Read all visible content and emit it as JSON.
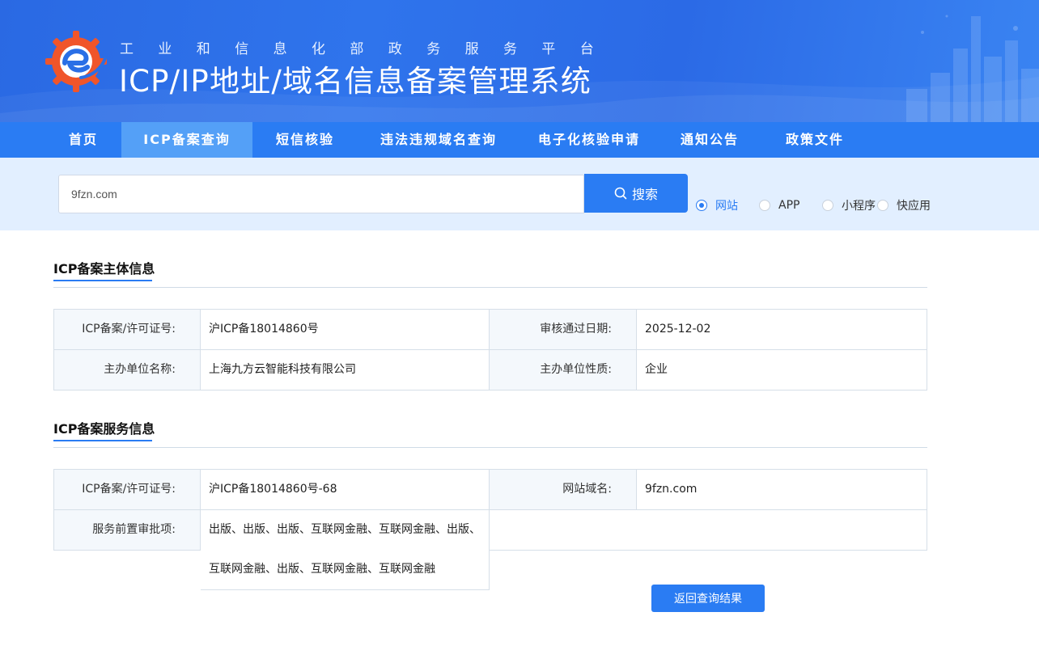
{
  "header": {
    "subtitle": "工业和信息化部政务服务平台",
    "title": "ICP/IP地址/域名信息备案管理系统"
  },
  "nav": {
    "items": [
      "首页",
      "ICP备案查询",
      "短信核验",
      "违法违规域名查询",
      "电子化核验申请",
      "通知公告",
      "政策文件"
    ],
    "active_index": 1
  },
  "search": {
    "value": "9fzn.com",
    "button_label": "搜索",
    "types": [
      "网站",
      "APP",
      "小程序",
      "快应用"
    ],
    "selected_type": "网站"
  },
  "subject_info": {
    "title": "ICP备案主体信息",
    "license_label": "ICP备案/许可证号:",
    "license_value": "沪ICP备18014860号",
    "approval_date_label": "审核通过日期:",
    "approval_date_value": "2025-12-02",
    "organizer_label": "主办单位名称:",
    "organizer_value": "上海九方云智能科技有限公司",
    "nature_label": "主办单位性质:",
    "nature_value": "企业"
  },
  "service_info": {
    "title": "ICP备案服务信息",
    "license_label": "ICP备案/许可证号:",
    "license_value": "沪ICP备18014860号-68",
    "domain_label": "网站域名:",
    "domain_value": "9fzn.com",
    "pre_approval_label": "服务前置审批项:",
    "pre_approval_line1": "出版、出版、出版、互联网金融、互联网金融、出版、",
    "pre_approval_line2": "互联网金融、出版、互联网金融、互联网金融"
  },
  "back_button_label": "返回查询结果",
  "colors": {
    "primary": "#2a7cf3",
    "nav_active": "#54a0f7",
    "search_band": "#e2efff",
    "label_cell": "#f4f8fc"
  }
}
